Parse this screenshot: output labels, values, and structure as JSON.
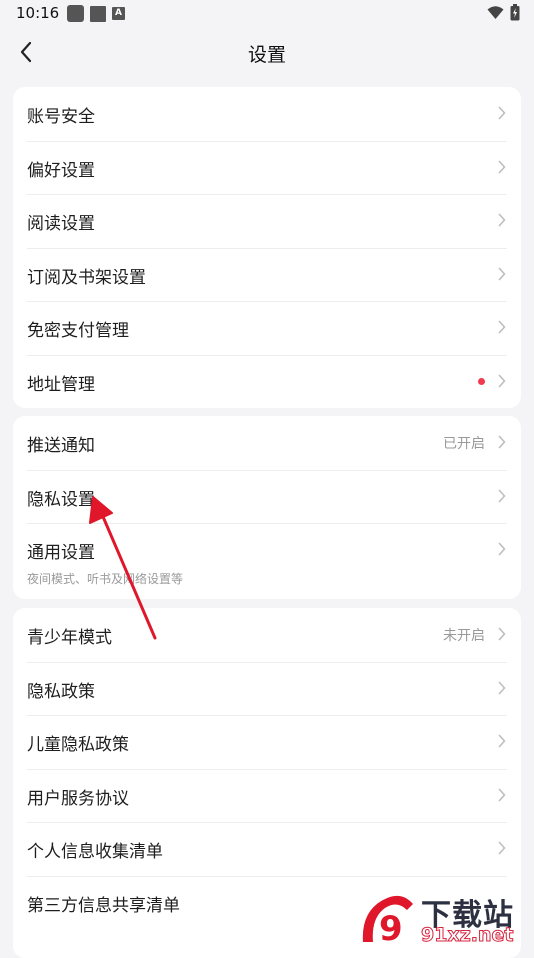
{
  "status_bar": {
    "time": "10:16",
    "notification_icon_letter": "A"
  },
  "nav": {
    "title": "设置"
  },
  "groups": [
    {
      "items": [
        {
          "label": "账号安全"
        },
        {
          "label": "偏好设置"
        },
        {
          "label": "阅读设置"
        },
        {
          "label": "订阅及书架设置"
        },
        {
          "label": "免密支付管理"
        },
        {
          "label": "地址管理",
          "badge_dot": true
        }
      ]
    },
    {
      "items": [
        {
          "label": "推送通知",
          "status": "已开启"
        },
        {
          "label": "隐私设置"
        },
        {
          "label": "通用设置",
          "subtitle": "夜间模式、听书及网络设置等"
        }
      ]
    },
    {
      "items": [
        {
          "label": "青少年模式",
          "status": "未开启"
        },
        {
          "label": "隐私政策"
        },
        {
          "label": "儿童隐私政策"
        },
        {
          "label": "用户服务协议"
        },
        {
          "label": "个人信息收集清单"
        },
        {
          "label": "第三方信息共享清单"
        }
      ]
    }
  ],
  "watermark": {
    "brand": "下载站",
    "url": "91xz.net",
    "logo_text": "9"
  },
  "colors": {
    "background": "#f4f4f6",
    "card": "#ffffff",
    "badge": "#f03a4f",
    "annotation_arrow": "#e0162b"
  }
}
